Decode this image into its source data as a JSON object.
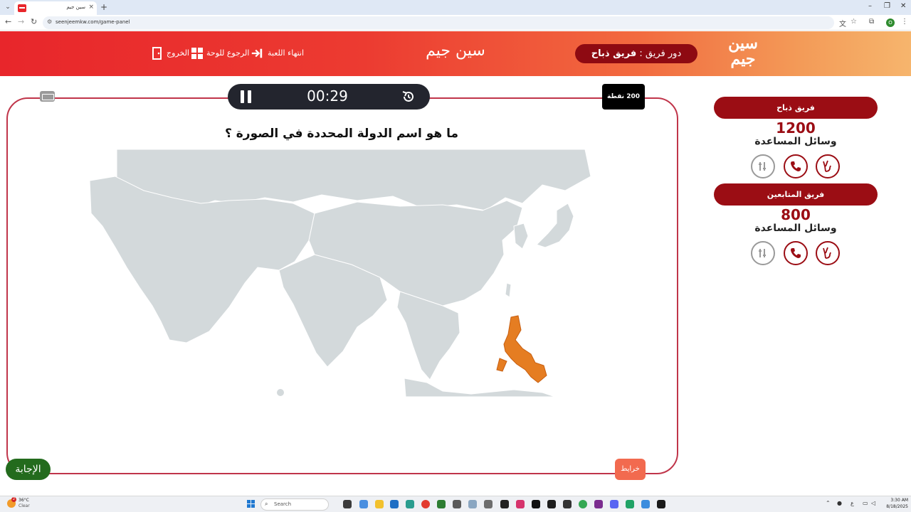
{
  "browser": {
    "tab_title": "سين جيم",
    "url": "seenjeemkw.com/game-panel"
  },
  "header": {
    "turn_prefix": "دور فريق :",
    "turn_team": "فريق ذباح",
    "brand": "سين جيم",
    "actions": [
      {
        "label": "انتهاء اللعبة",
        "icon": "exit-arrow-icon"
      },
      {
        "label": "الرجوع للوحة",
        "icon": "grid-icon"
      },
      {
        "label": "الخروج",
        "icon": "door-icon"
      }
    ],
    "logo_line1": "سين",
    "logo_line2": "جيم"
  },
  "game": {
    "timer": "00:29",
    "points": "200 نقطة",
    "question": "ما هو اسم الدولة المحددة في الصورة ؟",
    "answer_button": "الإجابة",
    "maps_button": "خرايط",
    "highlight_color": "#e57d22",
    "land_color": "#d3d9db"
  },
  "teams": [
    {
      "name": "فريق ذباح",
      "score": "1200",
      "aids_label": "وسائل المساعدة"
    },
    {
      "name": "فريق المتابعين",
      "score": "800",
      "aids_label": "وسائل المساعدة"
    }
  ],
  "taskbar": {
    "weather_temp": "36°C",
    "weather_cond": "Clear",
    "weather_badge": "2",
    "search_placeholder": "Search",
    "time": "3:30 AM",
    "date": "8/18/2025"
  },
  "colors": {
    "brand_red": "#e8262b",
    "dark_red": "#9b0d14",
    "answer_green": "#236b1d",
    "maps_orange": "#f26a4f"
  }
}
